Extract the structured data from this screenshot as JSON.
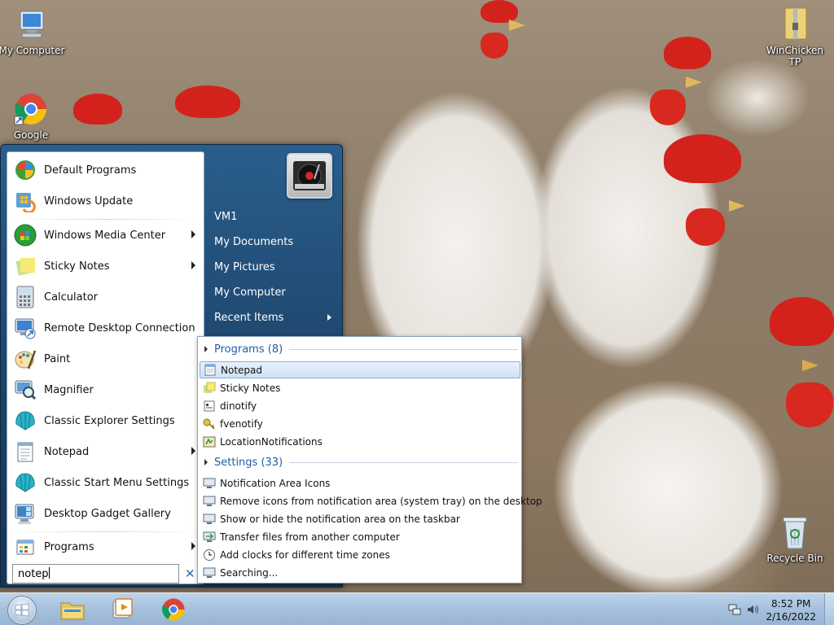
{
  "desktop": {
    "icons": [
      {
        "label": "My Computer"
      },
      {
        "label": "Google"
      },
      {
        "label": "WinChicken TP"
      },
      {
        "label": "Recycle Bin"
      }
    ]
  },
  "start_menu": {
    "left_items": [
      {
        "label": "Default Programs",
        "icon": "default-programs-icon",
        "arrow": false
      },
      {
        "label": "Windows Update",
        "icon": "windows-update-icon",
        "arrow": false
      },
      {
        "label": "Windows Media Center",
        "icon": "media-center-icon",
        "arrow": true
      },
      {
        "label": "Sticky Notes",
        "icon": "sticky-notes-icon",
        "arrow": true
      },
      {
        "label": "Calculator",
        "icon": "calculator-icon",
        "arrow": false
      },
      {
        "label": "Remote Desktop Connection",
        "icon": "remote-desktop-icon",
        "arrow": false
      },
      {
        "label": "Paint",
        "icon": "paint-icon",
        "arrow": false
      },
      {
        "label": "Magnifier",
        "icon": "magnifier-icon",
        "arrow": false
      },
      {
        "label": "Classic Explorer Settings",
        "icon": "shell-icon",
        "arrow": false
      },
      {
        "label": "Notepad",
        "icon": "notepad-icon",
        "arrow": true
      },
      {
        "label": "Classic Start Menu Settings",
        "icon": "shell-icon",
        "arrow": false
      },
      {
        "label": "Desktop Gadget Gallery",
        "icon": "gadget-icon",
        "arrow": false
      }
    ],
    "programs_label": "Programs",
    "search_value": "notep",
    "right_items": [
      {
        "label": "VM1",
        "arrow": false
      },
      {
        "label": "My Documents",
        "arrow": false
      },
      {
        "label": "My Pictures",
        "arrow": false
      },
      {
        "label": "My Computer",
        "arrow": false
      },
      {
        "label": "Recent Items",
        "arrow": true
      }
    ]
  },
  "search_results": {
    "programs_header": "Programs (8)",
    "programs": [
      {
        "label": "Notepad",
        "icon": "notepad-icon",
        "selected": true
      },
      {
        "label": "Sticky Notes",
        "icon": "sticky-notes-icon",
        "selected": false
      },
      {
        "label": "dinotify",
        "icon": "app-icon",
        "selected": false
      },
      {
        "label": "fvenotify",
        "icon": "key-icon",
        "selected": false
      },
      {
        "label": "LocationNotifications",
        "icon": "location-icon",
        "selected": false
      }
    ],
    "settings_header": "Settings (33)",
    "settings": [
      {
        "label": "Notification Area Icons",
        "icon": "monitor-icon"
      },
      {
        "label": "Remove icons from notification area (system tray) on the desktop",
        "icon": "monitor-icon"
      },
      {
        "label": "Show or hide the notification area on the taskbar",
        "icon": "monitor-icon"
      },
      {
        "label": "Transfer files from another computer",
        "icon": "transfer-icon"
      },
      {
        "label": "Add clocks for different time zones",
        "icon": "clock-icon"
      },
      {
        "label": "Searching...",
        "icon": "search-icon"
      }
    ]
  },
  "taskbar": {
    "time": "8:52 PM",
    "date": "2/16/2022"
  }
}
